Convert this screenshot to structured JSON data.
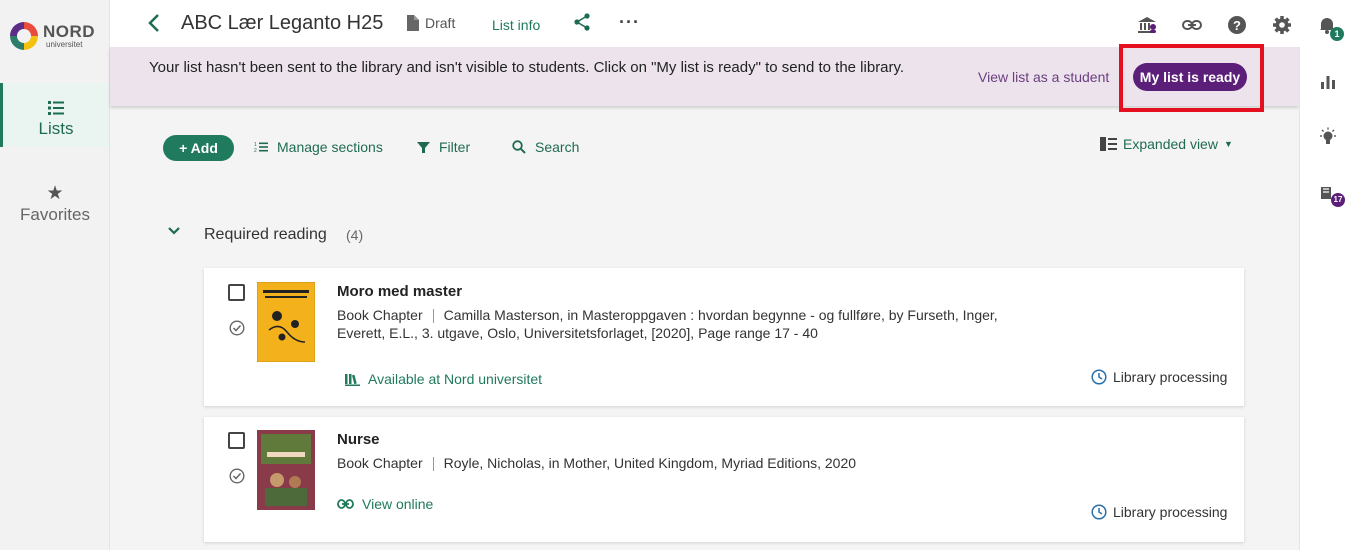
{
  "brand": {
    "name": "NORD",
    "sub": "universitet"
  },
  "leftnav": {
    "items": [
      {
        "label": "Lists",
        "icon": "list-icon",
        "active": true
      },
      {
        "label": "Favorites",
        "icon": "star-icon",
        "active": false
      }
    ]
  },
  "header": {
    "title": "ABC Lær Leganto H25",
    "status": "Draft",
    "list_info": "List info",
    "more": "···",
    "notification_count": "1"
  },
  "banner": {
    "message": "Your list hasn't been sent to the library and isn't visible to students. Click on \"My list is ready\" to send to the library.",
    "view_as_student": "View list as a student",
    "ready_button": "My list is ready"
  },
  "toolbar": {
    "add": "Add",
    "manage_sections": "Manage sections",
    "filter": "Filter",
    "search": "Search",
    "view_mode": "Expanded view"
  },
  "section": {
    "title": "Required reading",
    "count": "(4)"
  },
  "items": [
    {
      "title": "Moro med master",
      "type": "Book Chapter",
      "citation_line1": "Camilla Masterson, in Masteroppgaven : hvordan begynne - og fullføre, by Furseth, Inger,",
      "citation_line2": "Everett, E.L., 3. utgave, Oslo, Universitetsforlaget, [2020], Page range 17 - 40",
      "availability": "Available at Nord universitet",
      "status": "Library processing",
      "cover_color": "#f3b21b"
    },
    {
      "title": "Nurse",
      "type": "Book Chapter",
      "citation_line1": "Royle, Nicholas, in Mother, United Kingdom, Myriad Editions, 2020",
      "availability": "View online",
      "status": "Library processing",
      "cover_color": "#8a3b4a"
    }
  ],
  "rightrail": {
    "badge": "17"
  },
  "colors": {
    "accent": "#1f7a5e",
    "purple": "#5b1f7a",
    "banner": "#ece3ec",
    "highlight": "#e5101f"
  }
}
